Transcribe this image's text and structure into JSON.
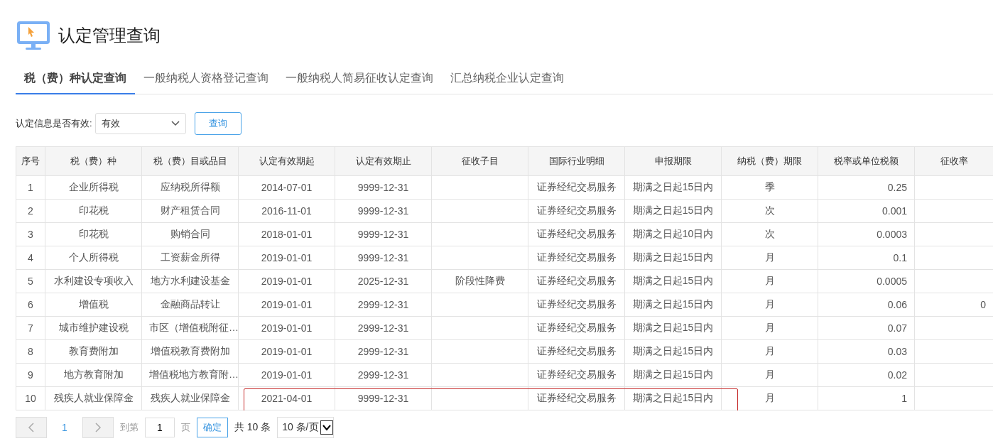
{
  "page": {
    "title": "认定管理查询"
  },
  "tabs": [
    {
      "label": "税（费）种认定查询",
      "selected": true
    },
    {
      "label": "一般纳税人资格登记查询",
      "selected": false
    },
    {
      "label": "一般纳税人简易征收认定查询",
      "selected": false
    },
    {
      "label": "汇总纳税企业认定查询",
      "selected": false
    }
  ],
  "filter": {
    "label": "认定信息是否有效:",
    "value": "有效",
    "button": "查询"
  },
  "table": {
    "columns": [
      "序号",
      "税（费）种",
      "税（费）目或品目",
      "认定有效期起",
      "认定有效期止",
      "征收子目",
      "国际行业明细",
      "申报期限",
      "纳税（费）期限",
      "税率或单位税额",
      "征收率"
    ],
    "rows": [
      {
        "cells": [
          "1",
          "企业所得税",
          "应纳税所得额",
          "2014-07-01",
          "9999-12-31",
          "",
          "证券经纪交易服务",
          "期满之日起15日内",
          "季",
          "0.25",
          ""
        ],
        "highlighted": false
      },
      {
        "cells": [
          "2",
          "印花税",
          "财产租赁合同",
          "2016-11-01",
          "9999-12-31",
          "",
          "证券经纪交易服务",
          "期满之日起15日内",
          "次",
          "0.001",
          ""
        ],
        "highlighted": false
      },
      {
        "cells": [
          "3",
          "印花税",
          "购销合同",
          "2018-01-01",
          "9999-12-31",
          "",
          "证券经纪交易服务",
          "期满之日起10日内",
          "次",
          "0.0003",
          ""
        ],
        "highlighted": false
      },
      {
        "cells": [
          "4",
          "个人所得税",
          "工资薪金所得",
          "2019-01-01",
          "9999-12-31",
          "",
          "证券经纪交易服务",
          "期满之日起15日内",
          "月",
          "0.1",
          ""
        ],
        "highlighted": false
      },
      {
        "cells": [
          "5",
          "水利建设专项收入",
          "地方水利建设基金",
          "2019-01-01",
          "2025-12-31",
          "阶段性降费",
          "证券经纪交易服务",
          "期满之日起15日内",
          "月",
          "0.0005",
          ""
        ],
        "highlighted": false
      },
      {
        "cells": [
          "6",
          "增值税",
          "金融商品转让",
          "2019-01-01",
          "2999-12-31",
          "",
          "证券经纪交易服务",
          "期满之日起15日内",
          "月",
          "0.06",
          "0"
        ],
        "highlighted": false
      },
      {
        "cells": [
          "7",
          "城市维护建设税",
          "市区（增值税附征…",
          "2019-01-01",
          "2999-12-31",
          "",
          "证券经纪交易服务",
          "期满之日起15日内",
          "月",
          "0.07",
          ""
        ],
        "highlighted": false
      },
      {
        "cells": [
          "8",
          "教育费附加",
          "增值税教育费附加",
          "2019-01-01",
          "2999-12-31",
          "",
          "证券经纪交易服务",
          "期满之日起15日内",
          "月",
          "0.03",
          ""
        ],
        "highlighted": false
      },
      {
        "cells": [
          "9",
          "地方教育附加",
          "增值税地方教育附…",
          "2019-01-01",
          "2999-12-31",
          "",
          "证券经纪交易服务",
          "期满之日起15日内",
          "月",
          "0.02",
          ""
        ],
        "highlighted": false
      },
      {
        "cells": [
          "10",
          "残疾人就业保障金",
          "残疾人就业保障金",
          "2021-04-01",
          "9999-12-31",
          "",
          "证券经纪交易服务",
          "期满之日起15日内",
          "月",
          "1",
          ""
        ],
        "highlighted": true
      }
    ]
  },
  "pagination": {
    "prev_disabled": true,
    "next_disabled": true,
    "pages": [
      {
        "label": "1",
        "selected": true
      }
    ],
    "goto_label": "到第",
    "goto_value": "1",
    "page_unit": "页",
    "confirm": "确定",
    "total": "共 10 条",
    "page_size": "10 条/页"
  }
}
